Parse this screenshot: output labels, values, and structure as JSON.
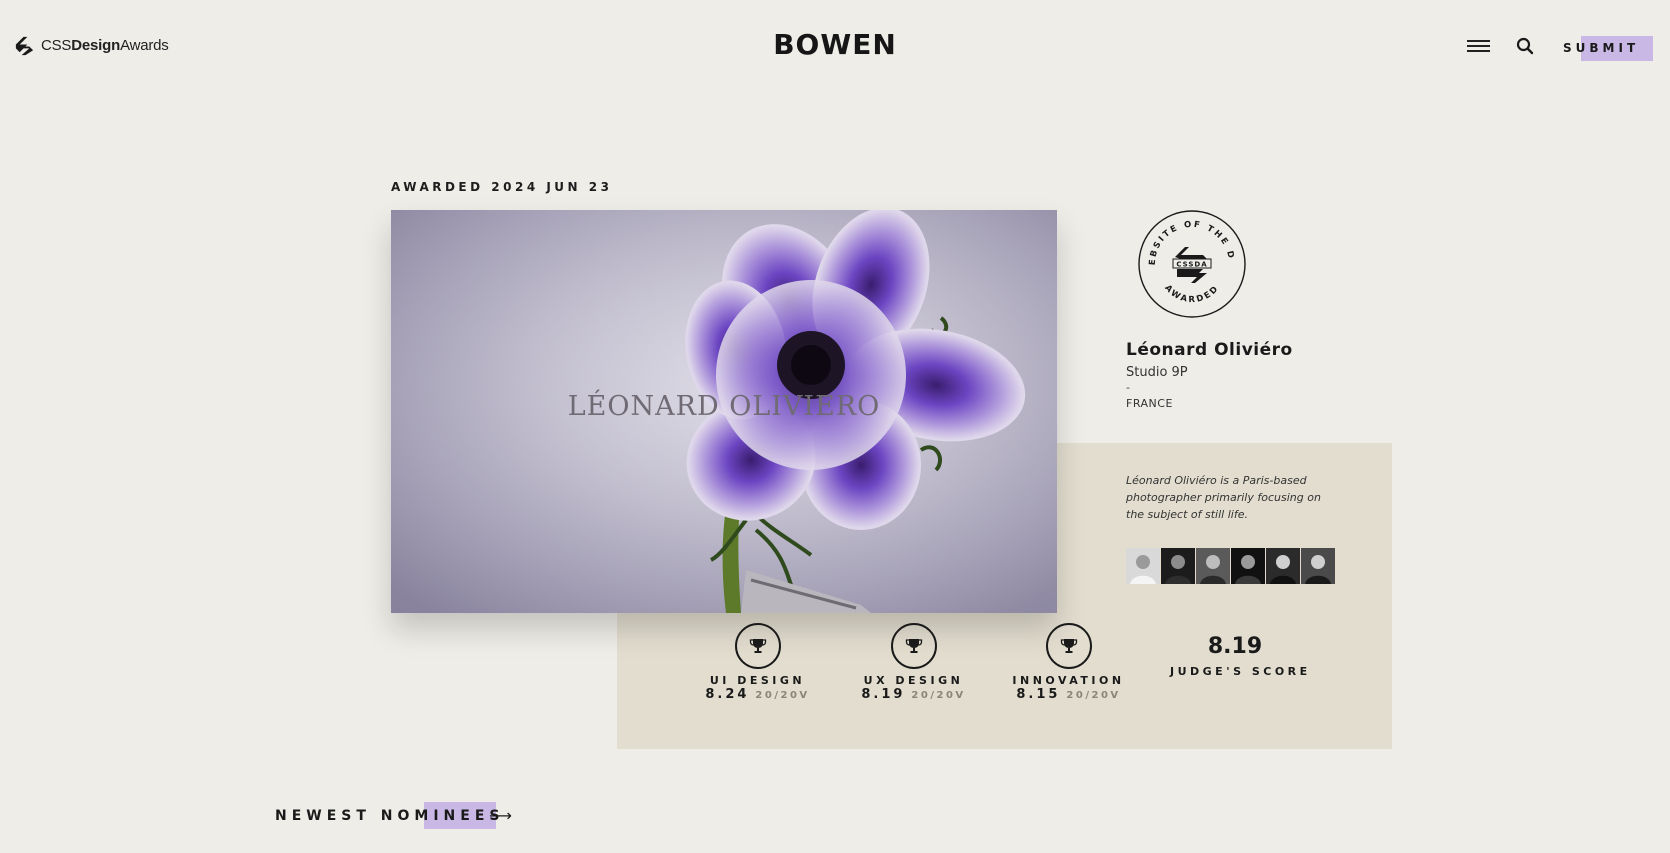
{
  "header": {
    "logo": {
      "css": "CSS",
      "design": "Design",
      "awards": "Awards"
    },
    "brand_title": "BOWEN",
    "menu_icon": "hamburger-icon",
    "search_icon": "search-icon",
    "submit_label": "SUBMIT",
    "accent_color": "#c9b8e6"
  },
  "award": {
    "date_label": "AWARDED 2024 JUN 23",
    "hero_title": "LÉONARD OLIVIERO",
    "badge": {
      "top_text": "WEBSITE OF THE DAY",
      "center_text": "CSSDA",
      "bottom_text": "AWARDED"
    }
  },
  "creator": {
    "name": "Léonard Oliviéro",
    "studio": "Studio 9P",
    "separator": "-",
    "country": "FRANCE",
    "description": "Léonard Oliviéro is a Paris-based photographer primarily focusing on the subject of still life."
  },
  "jury_count": 6,
  "scores": [
    {
      "label": "UI DESIGN",
      "value": "8.24",
      "votes": "20/20V"
    },
    {
      "label": "UX DESIGN",
      "value": "8.19",
      "votes": "20/20V"
    },
    {
      "label": "INNOVATION",
      "value": "8.15",
      "votes": "20/20V"
    }
  ],
  "judge_score": {
    "value": "8.19",
    "label": "JUDGE'S SCORE"
  },
  "newest": {
    "label": "NEWEST NOMINEES",
    "arrow": "⟶"
  },
  "colors": {
    "background": "#efede8",
    "panel": "#e2ddcf",
    "highlight": "#c9b8e6"
  }
}
